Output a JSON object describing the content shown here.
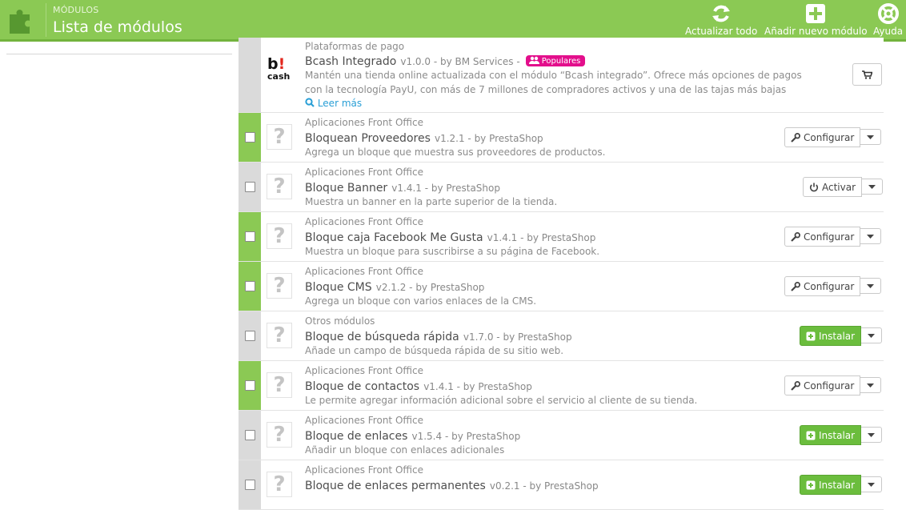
{
  "header": {
    "breadcrumb": "MÓDULOS",
    "title": "Lista de módulos",
    "colors": {
      "header_bg": "#8bc954",
      "enabled_bar": "#8bc954",
      "popular_badge": "#e30f8c",
      "link": "#2a9fd6"
    },
    "toolbar": [
      {
        "label": "Actualizar todo",
        "icon": "refresh-icon"
      },
      {
        "label": "Añadir nuevo módulo",
        "icon": "add-icon"
      },
      {
        "label": "Ayuda",
        "icon": "help-icon"
      }
    ]
  },
  "modules": [
    {
      "category": "Plataformas de pago",
      "name": "Bcash Integrado",
      "version": "v1.0.0 - by BM Services -",
      "badge": "Populares",
      "logo_b": "b",
      "logo_ex": "!",
      "logo_cash": "cash",
      "desc_line1": "Mantén una tienda online actualizada con el módulo “Bcash integrado”. Ofrece más opciones de pagos",
      "desc_line2": "con la tecnología PayU, con más de 7 millones de compradores activos y una de las tajas más bajas",
      "read_more": "Leer más",
      "action_icon": "cart-icon"
    },
    {
      "category": "Aplicaciones Front Office",
      "name": "Bloquean Proveedores",
      "version": "v1.2.1 - by PrestaShop",
      "description": "Agrega un bloque que muestra sus proveedores de productos.",
      "action": "Configurar",
      "icon": "?",
      "enabled": true
    },
    {
      "category": "Aplicaciones Front Office",
      "name": "Bloque Banner",
      "version": "v1.4.1 - by PrestaShop",
      "description": "Muestra un banner en la parte superior de la tienda.",
      "action": "Activar",
      "icon": "?",
      "enabled": false
    },
    {
      "category": "Aplicaciones Front Office",
      "name": "Bloque caja Facebook Me Gusta",
      "version": "v1.4.1 - by PrestaShop",
      "description": "Muestra un bloque para suscribirse a su página de Facebook.",
      "action": "Configurar",
      "icon": "?",
      "enabled": true
    },
    {
      "category": "Aplicaciones Front Office",
      "name": "Bloque CMS",
      "version": "v2.1.2 - by PrestaShop",
      "description": "Agrega un bloque con varios enlaces de la CMS.",
      "action": "Configurar",
      "icon": "?",
      "enabled": true
    },
    {
      "category": "Otros módulos",
      "name": "Bloque de búsqueda rápida",
      "version": "v1.7.0 - by PrestaShop",
      "description": "Añade un campo de búsqueda rápida de su sitio web.",
      "action": "Instalar",
      "icon": "?",
      "enabled": false
    },
    {
      "category": "Aplicaciones Front Office",
      "name": "Bloque de contactos",
      "version": "v1.4.1 - by PrestaShop",
      "description": "Le permite agregar información adicional sobre el servicio al cliente de su tienda.",
      "action": "Configurar",
      "icon": "?",
      "enabled": true
    },
    {
      "category": "Aplicaciones Front Office",
      "name": "Bloque de enlaces",
      "version": "v1.5.4 - by PrestaShop",
      "description": "Añadir un bloque con enlaces adicionales",
      "action": "Instalar",
      "icon": "?",
      "enabled": false
    },
    {
      "category": "Aplicaciones Front Office",
      "name": "Bloque de enlaces permanentes",
      "version": "v0.2.1 - by PrestaShop",
      "description": "",
      "action": "Instalar",
      "icon": "?",
      "enabled": false
    }
  ]
}
